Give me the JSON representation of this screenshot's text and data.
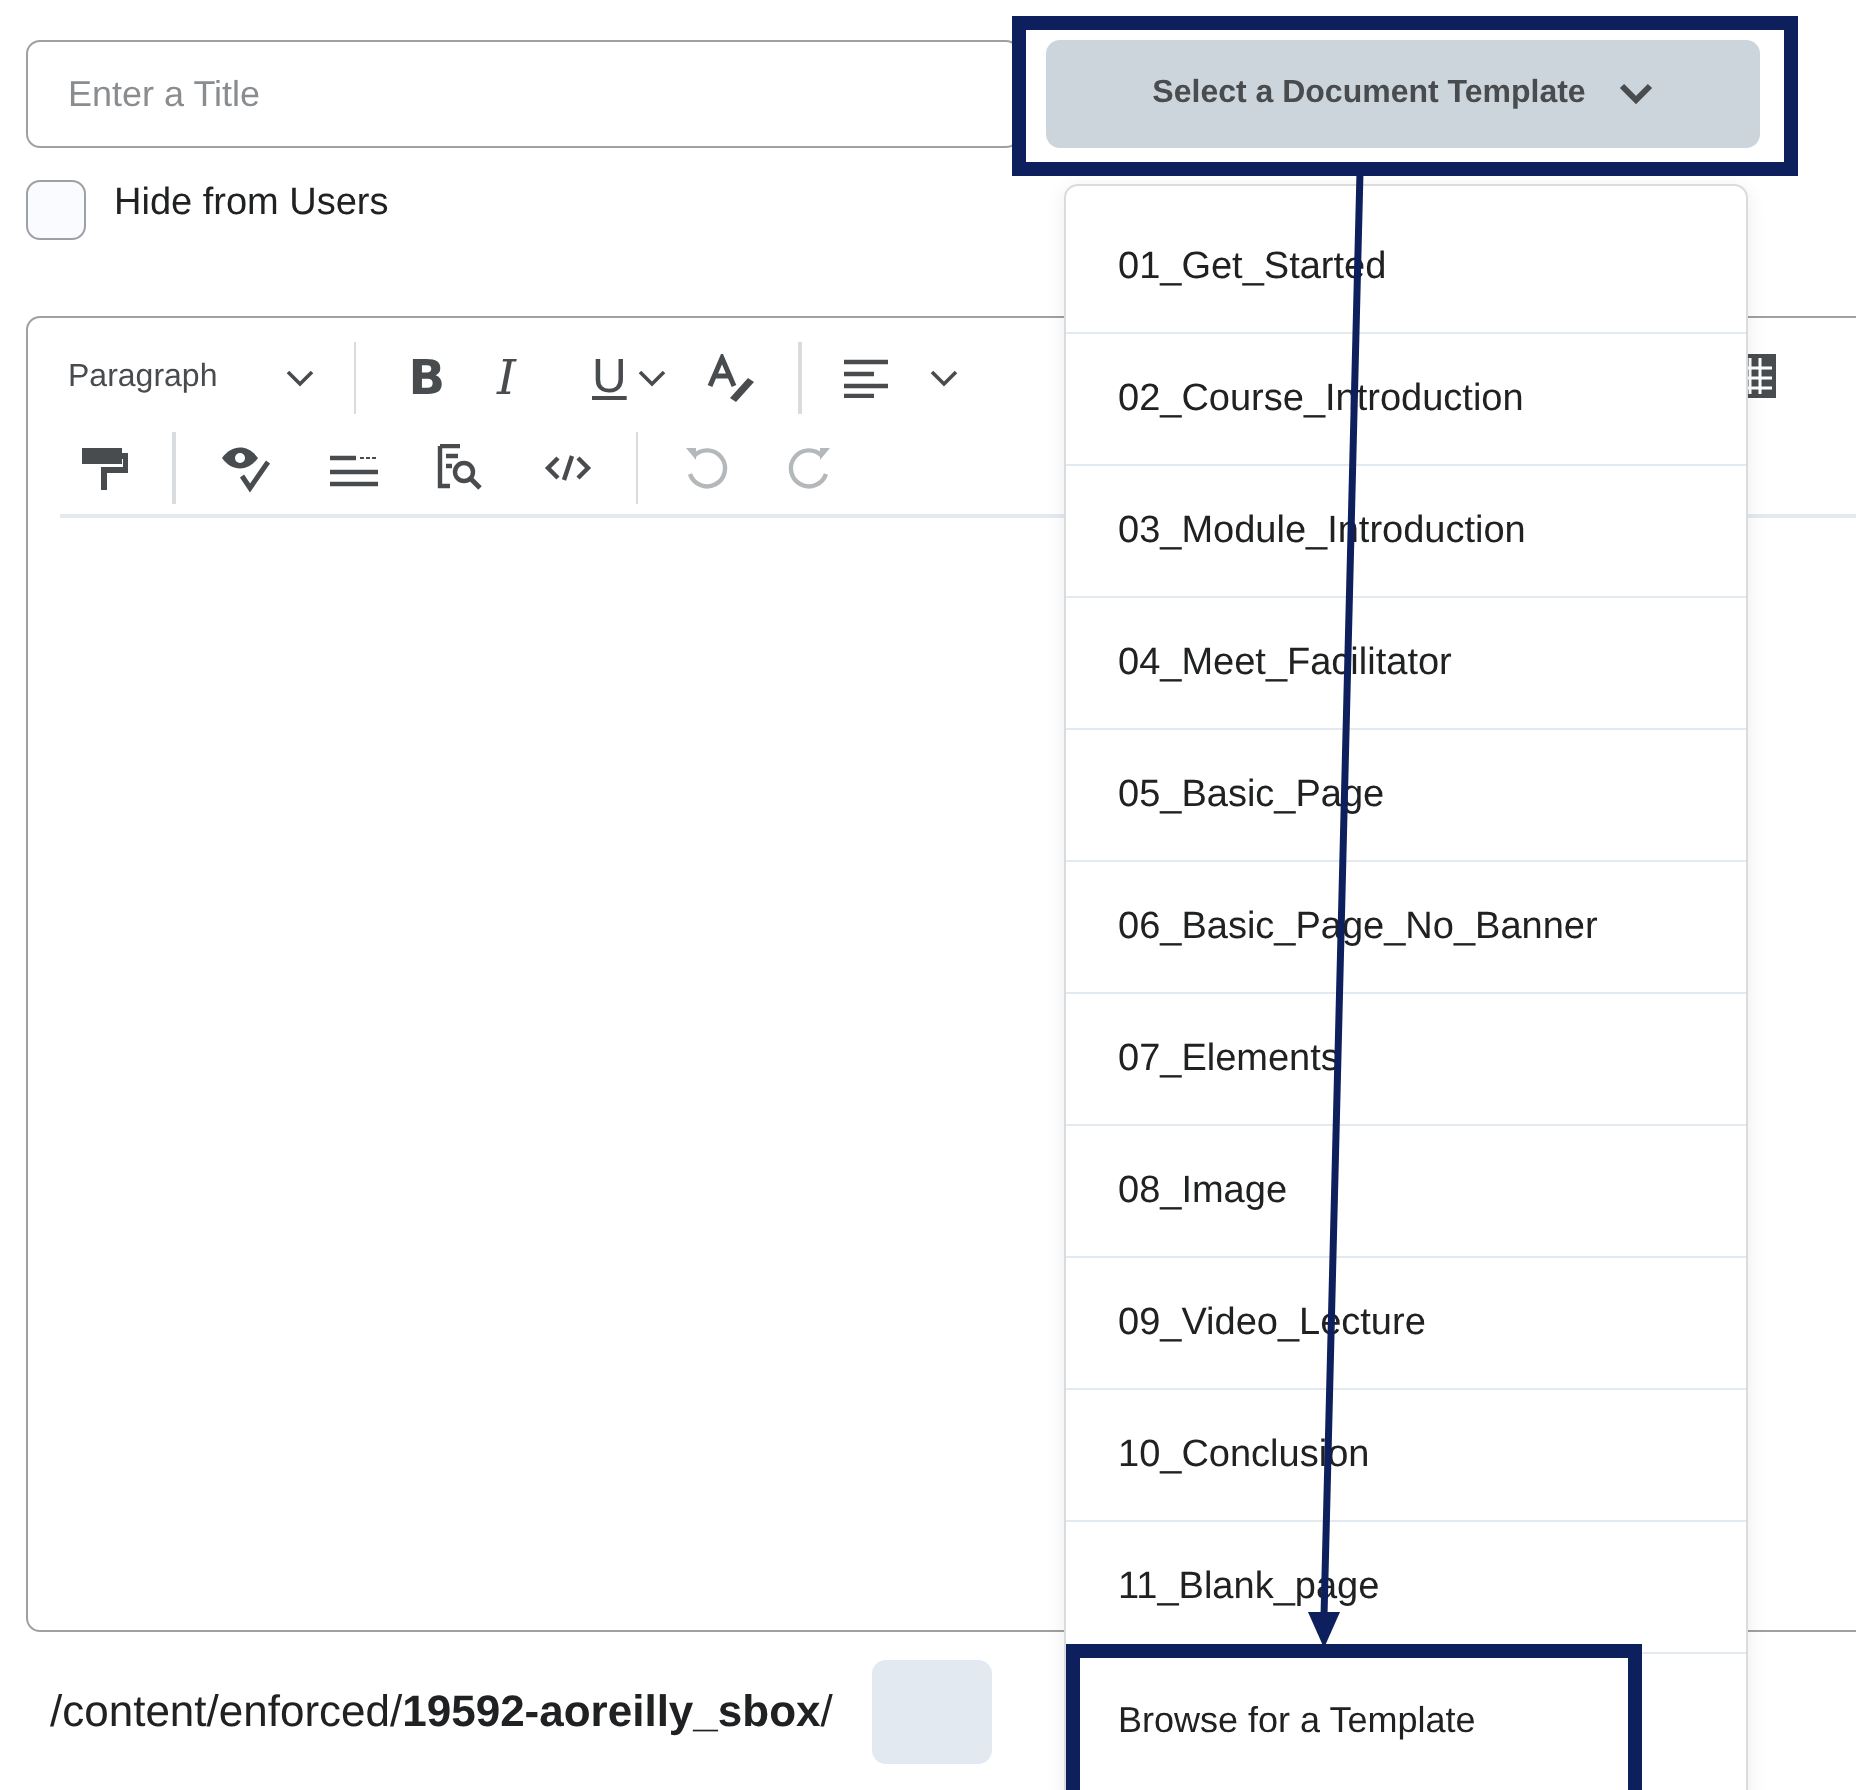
{
  "title_field": {
    "placeholder": "Enter a Title"
  },
  "hide_from_users": {
    "label": "Hide from Users",
    "checked": false
  },
  "template_button": {
    "label": "Select a Document Template"
  },
  "toolbar": [
    {
      "kind": "select",
      "label": "Paragraph"
    },
    {
      "kind": "bold",
      "label": "B"
    },
    {
      "kind": "italic",
      "label": "I"
    },
    {
      "kind": "underline",
      "label": "U"
    }
  ],
  "template_menu": {
    "items": [
      "01_Get_Started",
      "02_Course_Introduction",
      "03_Module_Introduction",
      "04_Meet_Facilitator",
      "05_Basic_Page",
      "06_Basic_Page_No_Banner",
      "07_Elements",
      "08_Image",
      "09_Video_Lecture",
      "10_Conclusion",
      "11_Blank_page"
    ],
    "footer": "Browse for a Template"
  },
  "path": "/content/enforced/**19592-aoreilly_sbox**/"
}
